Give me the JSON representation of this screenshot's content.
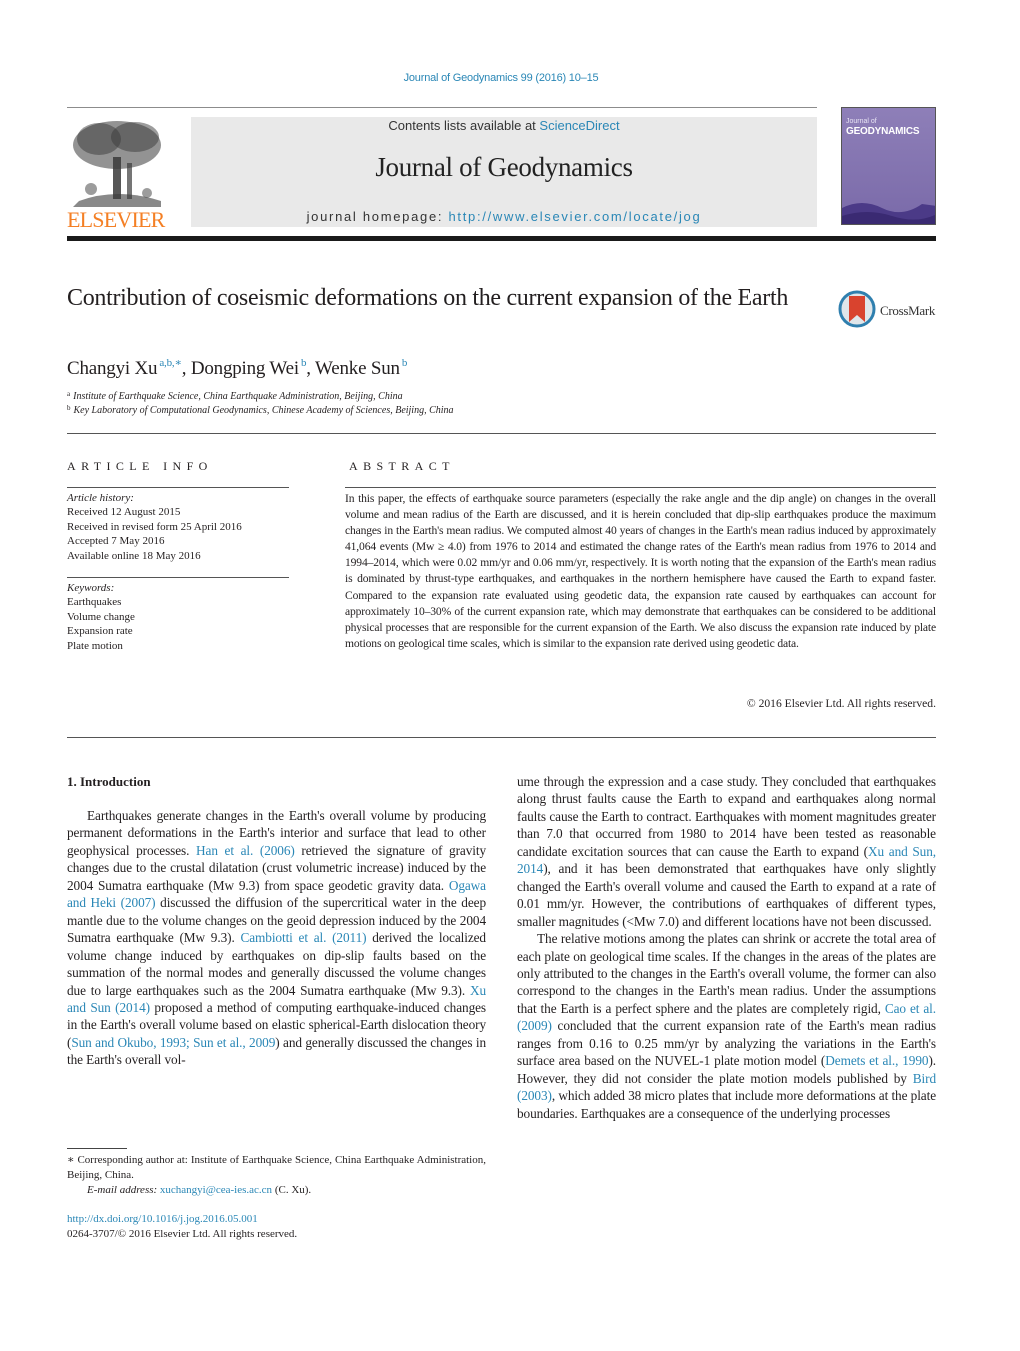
{
  "running_head": "Journal of Geodynamics 99 (2016) 10–15",
  "publisher": {
    "logo_word": "ELSEVIER",
    "logo_color": "#f47f24"
  },
  "banner": {
    "contents_prefix": "Contents lists available at ",
    "contents_link": "ScienceDirect",
    "journal_title": "Journal of Geodynamics",
    "homepage_prefix": "journal homepage: ",
    "homepage_url": "http://www.elsevier.com/locate/jog"
  },
  "cover": {
    "line1": "Journal of",
    "line2": "GEODYNAMICS"
  },
  "crossmark": {
    "label": "CrossMark"
  },
  "article": {
    "title": "Contribution of coseismic deformations on the current expansion of the Earth",
    "authors": [
      {
        "name": "Changyi Xu",
        "marks": "a,b,∗"
      },
      {
        "name": "Dongping Wei",
        "marks": "b"
      },
      {
        "name": "Wenke Sun",
        "marks": "b"
      }
    ],
    "affiliations": [
      {
        "mark": "a",
        "text": "Institute of Earthquake Science, China Earthquake Administration, Beijing, China"
      },
      {
        "mark": "b",
        "text": "Key Laboratory of Computational Geodynamics, Chinese Academy of Sciences, Beijing, China"
      }
    ]
  },
  "article_info": {
    "heading": "ARTICLE INFO",
    "history_heading": "Article history:",
    "history": [
      "Received 12 August 2015",
      "Received in revised form 25 April 2016",
      "Accepted 7 May 2016",
      "Available online 18 May 2016"
    ],
    "keywords_heading": "Keywords:",
    "keywords": [
      "Earthquakes",
      "Volume change",
      "Expansion rate",
      "Plate motion"
    ]
  },
  "abstract": {
    "heading": "ABSTRACT",
    "text": "In this paper, the effects of earthquake source parameters (especially the rake angle and the dip angle) on changes in the overall volume and mean radius of the Earth are discussed, and it is herein concluded that dip-slip earthquakes produce the maximum changes in the Earth's mean radius. We computed almost 40 years of changes in the Earth's mean radius induced by approximately 41,064 events (Mw ≥ 4.0) from 1976 to 2014 and estimated the change rates of the Earth's mean radius from 1976 to 2014 and 1994–2014, which were 0.02 mm/yr and 0.06 mm/yr, respectively. It is worth noting that the expansion of the Earth's mean radius is dominated by thrust-type earthquakes, and earthquakes in the northern hemisphere have caused the Earth to expand faster. Compared to the expansion rate evaluated using geodetic data, the expansion rate caused by earthquakes can account for approximately 10–30% of the current expansion rate, which may demonstrate that earthquakes can be considered to be additional physical processes that are responsible for the current expansion of the Earth. We also discuss the expansion rate induced by plate motions on geological time scales, which is similar to the expansion rate derived using geodetic data.",
    "copyright": "© 2016 Elsevier Ltd. All rights reserved."
  },
  "body": {
    "section_heading": "1.  Introduction",
    "left": {
      "p1_a": "Earthquakes generate changes in the Earth's overall volume by producing permanent deformations in the Earth's interior and surface that lead to other geophysical processes. ",
      "ref_han": "Han et al. (2006)",
      "p1_b": " retrieved the signature of gravity changes due to the crustal dilatation (crust volumetric increase) induced by the 2004 Sumatra earthquake (Mw 9.3) from space geodetic gravity data. ",
      "ref_ogawa": "Ogawa and Heki (2007)",
      "p1_c": " discussed the diffusion of the supercritical water in the deep mantle due to the volume changes on the geoid depression induced by the 2004 Sumatra earthquake (Mw 9.3). ",
      "ref_cambiotti": "Cambiotti et al. (2011)",
      "p1_d": " derived the localized volume change induced by earthquakes on dip-slip faults based on the summation of the normal modes and generally discussed the volume changes due to large earthquakes such as the 2004 Sumatra earthquake (Mw 9.3). ",
      "ref_xusun": "Xu and Sun (2014)",
      "p1_e": " proposed a method of computing earthquake-induced changes in the Earth's overall volume based on elastic spherical-Earth dislocation theory (",
      "ref_sunokubo": "Sun and Okubo, 1993; Sun et al., 2009",
      "p1_f": ") and generally discussed the changes in the Earth's overall vol-"
    },
    "right": {
      "p1_a": "ume through the expression and a case study. They concluded that earthquakes along thrust faults cause the Earth to expand and earthquakes along normal faults cause the Earth to contract. Earthquakes with moment magnitudes greater than 7.0 that occurred from 1980 to 2014 have been tested as reasonable candidate excitation sources that can cause the Earth to expand (",
      "ref_xusun": "Xu and Sun, 2014",
      "p1_b": "), and it has been demonstrated that earthquakes have only slightly changed the Earth's overall volume and caused the Earth to expand at a rate of 0.01 mm/yr. However, the contributions of earthquakes of different types, smaller magnitudes (<Mw 7.0) and different locations have not been discussed.",
      "p2_a": "The relative motions among the plates can shrink or accrete the total area of each plate on geological time scales. If the changes in the areas of the plates are only attributed to the changes in the Earth's overall volume, the former can also correspond to the changes in the Earth's mean radius. Under the assumptions that the Earth is a perfect sphere and the plates are completely rigid, ",
      "ref_cao": "Cao et al. (2009)",
      "p2_b": " concluded that the current expansion rate of the Earth's mean radius ranges from 0.16 to 0.25 mm/yr by analyzing the variations in the Earth's surface area based on the NUVEL-1 plate motion model (",
      "ref_demets": "Demets et al., 1990",
      "p2_c": "). However, they did not consider the plate motion models published by ",
      "ref_bird": "Bird (2003)",
      "p2_d": ", which added 38 micro plates that include more deformations at the plate boundaries. Earthquakes are a consequence of the underlying processes"
    }
  },
  "footnotes": {
    "corresponding": "∗  Corresponding author at: Institute of Earthquake Science, China Earthquake Administration, Beijing, China.",
    "email_label": "E-mail address: ",
    "email": "xuchangyi@cea-ies.ac.cn",
    "email_suffix": " (C. Xu).",
    "doi": "http://dx.doi.org/10.1016/j.jog.2016.05.001",
    "issn_line": "0264-3707/© 2016 Elsevier Ltd. All rights reserved."
  },
  "colors": {
    "link": "#2a87b6",
    "banner_bg": "#e9e9e9",
    "cover": "#8e7fb8"
  }
}
